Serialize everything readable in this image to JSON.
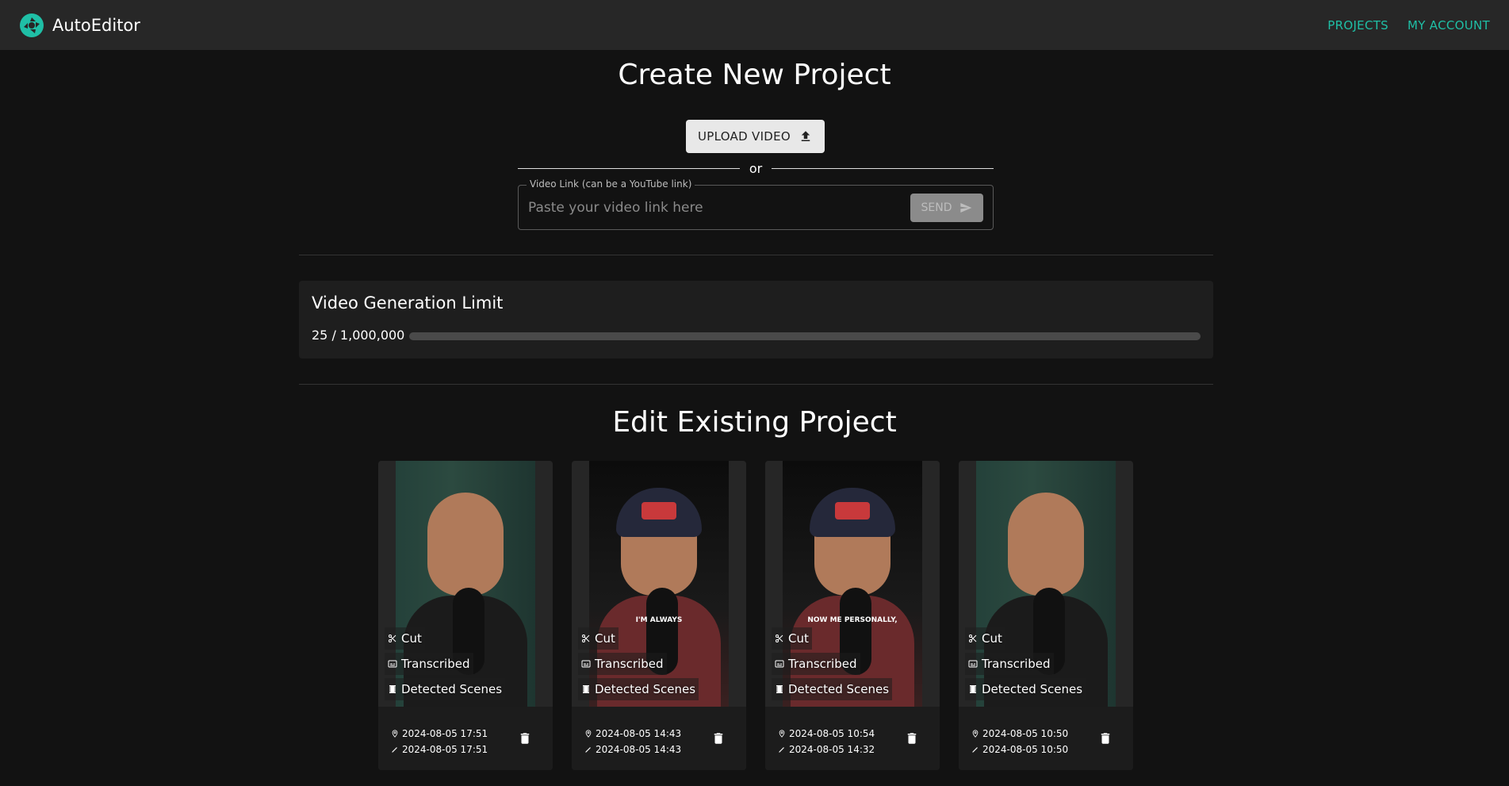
{
  "app": {
    "name": "AutoEditor",
    "nav": [
      "PROJECTS",
      "MY ACCOUNT"
    ]
  },
  "create": {
    "title": "Create New Project",
    "upload_label": "UPLOAD VIDEO",
    "or_label": "or",
    "link_legend": "Video Link (can be a YouTube link)",
    "link_placeholder": "Paste your video link here",
    "send_label": "SEND"
  },
  "limit": {
    "title": "Video Generation Limit",
    "count_text": "25 / 1,000,000",
    "used": 25,
    "max": 1000000
  },
  "edit": {
    "title": "Edit Existing Project",
    "projects": [
      {
        "caption": "",
        "tags": [
          "Cut",
          "Transcribed",
          "Detected Scenes"
        ],
        "created": "2024-08-05 17:51",
        "edited": "2024-08-05 17:51"
      },
      {
        "caption": "I'M ALWAYS",
        "tags": [
          "Cut",
          "Transcribed",
          "Detected Scenes"
        ],
        "created": "2024-08-05 14:43",
        "edited": "2024-08-05 14:43"
      },
      {
        "caption": "NOW ME PERSONALLY,",
        "tags": [
          "Cut",
          "Transcribed",
          "Detected Scenes"
        ],
        "created": "2024-08-05 10:54",
        "edited": "2024-08-05 14:32"
      },
      {
        "caption": "",
        "tags": [
          "Cut",
          "Transcribed",
          "Detected Scenes"
        ],
        "created": "2024-08-05 10:50",
        "edited": "2024-08-05 10:50"
      }
    ]
  },
  "colors": {
    "accent": "#1fbfa6",
    "appbar": "#272727",
    "background": "#121212"
  }
}
